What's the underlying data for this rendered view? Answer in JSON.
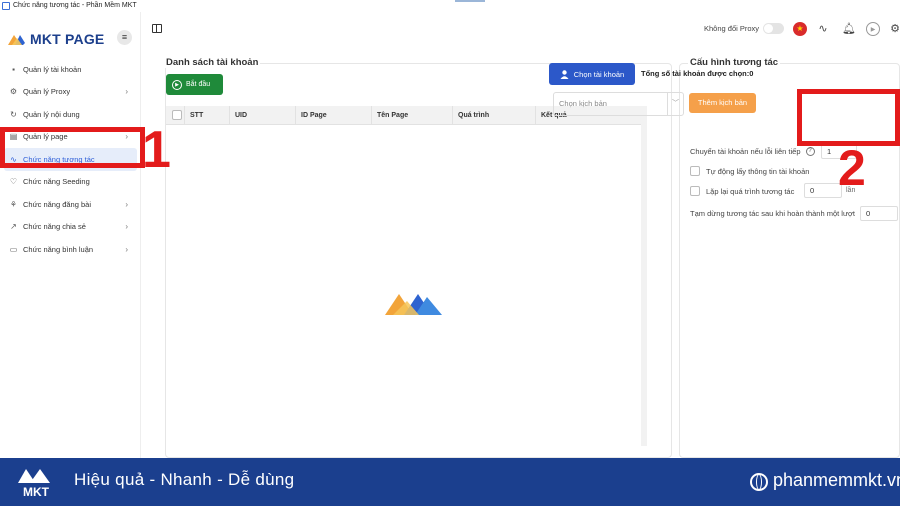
{
  "window": {
    "title": "Chức năng tương tác - Phần Mềm MKT"
  },
  "sidebar": {
    "logo_text": "MKT PAGE",
    "menu_icon": "hamburger-icon",
    "items": [
      {
        "label": "Quản lý tài khoản",
        "icon": "grid-icon",
        "has_children": false
      },
      {
        "label": "Quản lý Proxy",
        "icon": "proxy-icon",
        "has_children": true
      },
      {
        "label": "Quản lý nội dung",
        "icon": "content-icon",
        "has_children": false
      },
      {
        "label": "Quản lý page",
        "icon": "page-icon",
        "has_children": true
      },
      {
        "label": "Chức năng tương tác",
        "icon": "interaction-icon",
        "has_children": false,
        "active": true
      },
      {
        "label": "Chức năng Seeding",
        "icon": "seeding-icon",
        "has_children": false
      },
      {
        "label": "Chức năng đăng bài",
        "icon": "post-icon",
        "has_children": true
      },
      {
        "label": "Chức năng chia sẻ",
        "icon": "share-icon",
        "has_children": true
      },
      {
        "label": "Chức năng bình luận",
        "icon": "comment-icon",
        "has_children": true
      }
    ]
  },
  "topbar": {
    "proxy_label": "Không đổi Proxy",
    "proxy_toggle_on": false
  },
  "account_list": {
    "title": "Danh sách tài khoản",
    "start_button": "Bắt đầu",
    "columns": [
      "STT",
      "UID",
      "ID Page",
      "Tên Page",
      "Quá trình",
      "Kết quả"
    ],
    "rows": []
  },
  "config": {
    "title": "Cấu hình tương tác",
    "choose_account_button": "Chọn tài khoản",
    "total_label": "Tổng số tài khoản được chọn:0",
    "script_select_placeholder": "Chọn kịch bản",
    "add_script_button": "Thêm kịch bản",
    "switch_on_error_label": "Chuyển tài khoản nếu lỗi liên tiếp",
    "switch_on_error_value": "1",
    "auto_fetch_label": "Tự động lấy thông tin tài khoản",
    "repeat_label": "Lặp lại quá trình tương tác",
    "repeat_value": "0",
    "repeat_unit": "lần",
    "pause_label": "Tạm dừng tương tác sau khi hoàn thành một lượt",
    "pause_value": "0"
  },
  "annotations": {
    "one": "1",
    "two": "2"
  },
  "footer": {
    "slogan": "Hiệu quả - Nhanh  - Dễ dùng",
    "website": "phanmemmkt.vn"
  },
  "colors": {
    "brand_blue": "#1b3f8e",
    "primary": "#2c58c9",
    "success": "#1f8a3a",
    "orange": "#f5a04a",
    "annotation_red": "#e31b1b"
  }
}
